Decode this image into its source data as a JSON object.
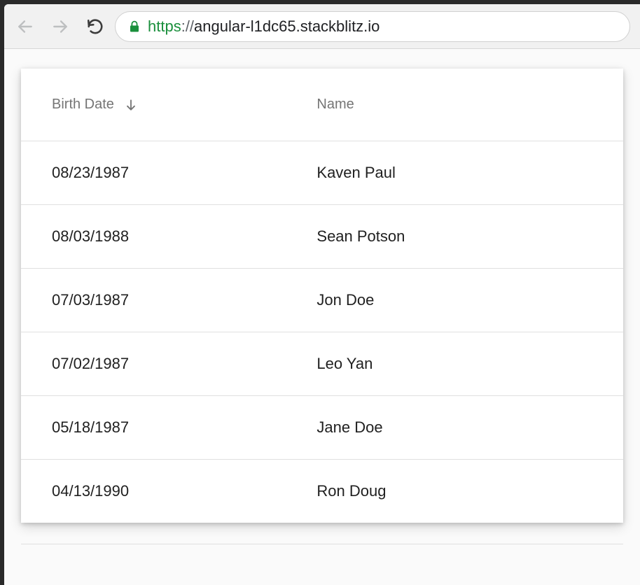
{
  "browser": {
    "url_scheme": "https",
    "url_sep": "://",
    "url_rest": "angular-l1dc65.stackblitz.io"
  },
  "table": {
    "columns": [
      {
        "label": "Birth Date",
        "sorted": true,
        "sort_dir": "desc"
      },
      {
        "label": "Name",
        "sorted": false
      }
    ],
    "rows": [
      {
        "birth_date": "08/23/1987",
        "name": "Kaven Paul"
      },
      {
        "birth_date": "08/03/1988",
        "name": "Sean Potson"
      },
      {
        "birth_date": "07/03/1987",
        "name": "Jon Doe"
      },
      {
        "birth_date": "07/02/1987",
        "name": "Leo Yan"
      },
      {
        "birth_date": "05/18/1987",
        "name": "Jane Doe"
      },
      {
        "birth_date": "04/13/1990",
        "name": "Ron Doug"
      }
    ]
  }
}
